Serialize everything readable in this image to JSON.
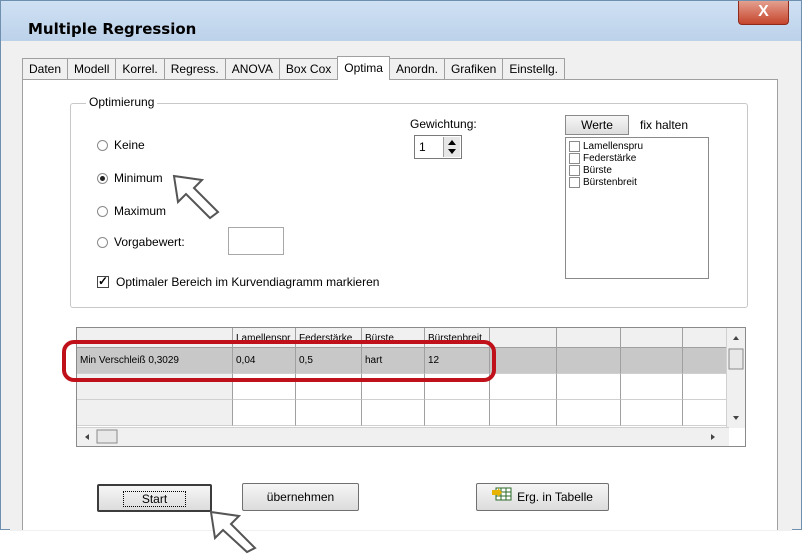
{
  "window": {
    "title": "Multiple Regression",
    "close_glyph": "X"
  },
  "tabs": [
    {
      "label": "Daten"
    },
    {
      "label": "Modell"
    },
    {
      "label": "Korrel."
    },
    {
      "label": "Regress."
    },
    {
      "label": "ANOVA"
    },
    {
      "label": "Box Cox"
    },
    {
      "label": "Optima",
      "active": true
    },
    {
      "label": "Anordn."
    },
    {
      "label": "Grafiken"
    },
    {
      "label": "Einstellg."
    }
  ],
  "optimierung": {
    "group_label": "Optimierung",
    "options": [
      {
        "label": "Keine",
        "checked": false
      },
      {
        "label": "Minimum",
        "checked": true
      },
      {
        "label": "Maximum",
        "checked": false
      },
      {
        "label": "Vorgabewert:",
        "checked": false
      }
    ],
    "vorgabe_value": "",
    "gewichtung_label": "Gewichtung:",
    "gewichtung_value": "1",
    "werte_button": "Werte",
    "fix_halten_label": "fix halten",
    "fix_items": [
      "Lamellenspru",
      "Federstärke",
      "Bürste",
      "Bürstenbreit"
    ],
    "markieren_label": "Optimaler Bereich im Kurvendiagramm markieren",
    "markieren_checked": true
  },
  "grid": {
    "headers": [
      "",
      "Lamellenspr",
      "Federstärke",
      "Bürste",
      "Bürstenbreit",
      "",
      "",
      "",
      ""
    ],
    "rows": [
      [
        "Min Verschleiß  0,3029",
        "0,04",
        "0,5",
        "hart",
        "12",
        "",
        "",
        "",
        ""
      ],
      [
        "",
        "",
        "",
        "",
        "",
        "",
        "",
        "",
        ""
      ],
      [
        "",
        "",
        "",
        "",
        "",
        "",
        "",
        "",
        ""
      ]
    ]
  },
  "buttons": {
    "start": "Start",
    "uebernehmen": "übernehmen",
    "erg_tabelle": "Erg. in Tabelle"
  },
  "colors": {
    "highlight": "#c0101a",
    "titlebar": "#bcd2ea",
    "close": "#c6452d"
  }
}
